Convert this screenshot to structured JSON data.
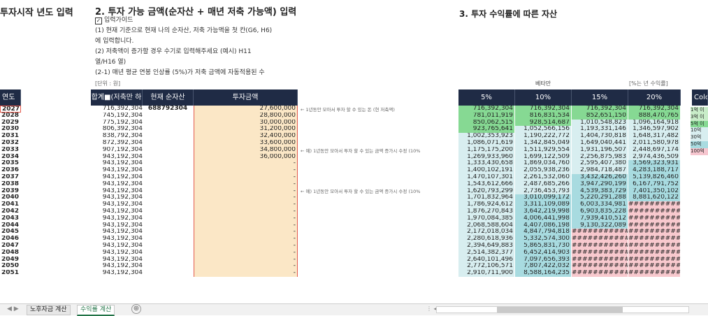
{
  "left_heading": "투자시작 년도 입력",
  "section2_title": "2. 투자 가능 금액(순자산 + 매년 저축 가능액) 입력",
  "section3_title": "3. 투자 수익률에 따른 자산",
  "guide_lines": [
    "입력가이드",
    "(1) 현재 기준으로 현재 나의 순자산, 저축 가능액을 첫 칸(G6, H6)",
    "에 입력합니다.",
    "(2) 저축액이 증가할 경우 수기로 입력해주세요 (예시) H11",
    "열/H16 열)",
    "(2-1) 매년 평균 연봉 인상률 (5%)가 저축 금액에 자동적용된 수"
  ],
  "unit_label": "[단위 : 원]",
  "vita_label": "베타만",
  "pct_label": "[%는 년 수익률]",
  "headers": {
    "year": "연도",
    "total": "합계■(저축만 하",
    "net": "현재 순자산",
    "invest": "투자금액",
    "r5": "5%",
    "r10": "10%",
    "r15": "15%",
    "r20": "20%",
    "color": "Colo"
  },
  "notes": [
    "← 1년동안 모아서 투자 할 수 있는 돈 (현 저축액)",
    "← 예) 1년동안 모아서 투자 할 수 있는 금액 증가시 수정 (10%",
    "← 예) 1년동안 모아서 투자 할 수 있는 금액 증가시 수정 (10%"
  ],
  "legend": [
    "1억 이",
    "3억 이",
    "5억 이",
    "10억",
    "30억",
    "50억",
    "100억"
  ],
  "colors": {
    "header_bg": "#1f2b45",
    "invest_bg": "#fbe7c6",
    "selection_border": "#e2584b",
    "green": "#86d993",
    "light_green": "#c8ecc8",
    "pale_teal": "#d8eef0",
    "teal": "#a8dbe0",
    "pink": "#f6c6cf",
    "overflow": "#f8c9ce"
  },
  "rows": [
    {
      "year": "2027",
      "total": "716,392,304",
      "net": "688792304",
      "invest": "27,600,000",
      "r5": "716,392,304",
      "r10": "716,392,304",
      "r15": "716,392,304",
      "r20": "716,392,304",
      "bg5": "green",
      "bg10": "green",
      "bg15": "green",
      "bg20": "green"
    },
    {
      "year": "2028",
      "total": "745,192,304",
      "net": "",
      "invest": "28,800,000",
      "r5": "781,011,919",
      "r10": "816,831,534",
      "r15": "852,651,150",
      "r20": "888,470,765",
      "bg5": "green",
      "bg10": "green",
      "bg15": "green",
      "bg20": "green"
    },
    {
      "year": "2029",
      "total": "775,192,304",
      "net": "",
      "invest": "30,000,000",
      "r5": "850,062,515",
      "r10": "928,514,687",
      "r15": "1,010,548,823",
      "r20": "1,096,164,918",
      "bg5": "green",
      "bg10": "green",
      "bg15": "pale_teal",
      "bg20": "pale_teal"
    },
    {
      "year": "2030",
      "total": "806,392,304",
      "net": "",
      "invest": "31,200,000",
      "r5": "923,765,641",
      "r10": "1,052,566,156",
      "r15": "1,193,331,146",
      "r20": "1,346,597,902",
      "bg5": "green",
      "bg10": "pale_teal",
      "bg15": "pale_teal",
      "bg20": "pale_teal"
    },
    {
      "year": "2031",
      "total": "838,792,304",
      "net": "",
      "invest": "32,400,000",
      "r5": "1,002,353,923",
      "r10": "1,190,222,772",
      "r15": "1,404,730,818",
      "r20": "1,648,317,482",
      "bg5": "pale_teal",
      "bg10": "pale_teal",
      "bg15": "pale_teal",
      "bg20": "pale_teal"
    },
    {
      "year": "2032",
      "total": "872,392,304",
      "net": "",
      "invest": "33,600,000",
      "r5": "1,086,071,619",
      "r10": "1,342,845,049",
      "r15": "1,649,040,441",
      "r20": "2,011,580,978",
      "bg5": "pale_teal",
      "bg10": "pale_teal",
      "bg15": "pale_teal",
      "bg20": "pale_teal"
    },
    {
      "year": "2033",
      "total": "907,192,304",
      "net": "",
      "invest": "34,800,000",
      "r5": "1,175,175,200",
      "r10": "1,511,929,554",
      "r15": "1,931,196,507",
      "r20": "2,448,697,174",
      "bg5": "pale_teal",
      "bg10": "pale_teal",
      "bg15": "pale_teal",
      "bg20": "pale_teal"
    },
    {
      "year": "2034",
      "total": "943,192,304",
      "net": "",
      "invest": "36,000,000",
      "r5": "1,269,933,960",
      "r10": "1,699,122,509",
      "r15": "2,256,875,983",
      "r20": "2,974,436,509",
      "bg5": "pale_teal",
      "bg10": "pale_teal",
      "bg15": "pale_teal",
      "bg20": "pale_teal"
    },
    {
      "year": "2035",
      "total": "943,192,304",
      "net": "",
      "invest": "-",
      "r5": "1,333,430,658",
      "r10": "1,869,034,760",
      "r15": "2,595,407,380",
      "r20": "3,569,323,931",
      "bg5": "pale_teal",
      "bg10": "pale_teal",
      "bg15": "pale_teal",
      "bg20": "teal"
    },
    {
      "year": "2036",
      "total": "943,192,304",
      "net": "",
      "invest": "-",
      "r5": "1,400,102,191",
      "r10": "2,055,938,236",
      "r15": "2,984,718,487",
      "r20": "4,283,188,717",
      "bg5": "pale_teal",
      "bg10": "pale_teal",
      "bg15": "pale_teal",
      "bg20": "teal"
    },
    {
      "year": "2037",
      "total": "943,192,304",
      "net": "",
      "invest": "-",
      "r5": "1,470,107,301",
      "r10": "2,261,532,060",
      "r15": "3,432,426,260",
      "r20": "5,139,826,460",
      "bg5": "pale_teal",
      "bg10": "pale_teal",
      "bg15": "teal",
      "bg20": "teal"
    },
    {
      "year": "2038",
      "total": "943,192,304",
      "net": "",
      "invest": "-",
      "r5": "1,543,612,666",
      "r10": "2,487,685,266",
      "r15": "3,947,290,199",
      "r20": "6,167,791,752",
      "bg5": "pale_teal",
      "bg10": "pale_teal",
      "bg15": "teal",
      "bg20": "teal"
    },
    {
      "year": "2039",
      "total": "943,192,304",
      "net": "",
      "invest": "-",
      "r5": "1,620,793,299",
      "r10": "2,736,453,793",
      "r15": "4,539,383,729",
      "r20": "7,401,350,102",
      "bg5": "pale_teal",
      "bg10": "pale_teal",
      "bg15": "teal",
      "bg20": "teal"
    },
    {
      "year": "2040",
      "total": "943,192,304",
      "net": "",
      "invest": "-",
      "r5": "1,701,832,964",
      "r10": "3,010,099,172",
      "r15": "5,220,291,288",
      "r20": "8,881,620,122",
      "bg5": "pale_teal",
      "bg10": "teal",
      "bg15": "teal",
      "bg20": "teal"
    },
    {
      "year": "2041",
      "total": "943,192,304",
      "net": "",
      "invest": "-",
      "r5": "1,786,924,612",
      "r10": "3,311,109,089",
      "r15": "6,003,334,981",
      "r20": "############",
      "bg5": "pale_teal",
      "bg10": "teal",
      "bg15": "teal",
      "bg20": "overflow"
    },
    {
      "year": "2042",
      "total": "943,192,304",
      "net": "",
      "invest": "-",
      "r5": "1,876,270,843",
      "r10": "3,642,219,998",
      "r15": "6,903,835,228",
      "r20": "############",
      "bg5": "pale_teal",
      "bg10": "teal",
      "bg15": "teal",
      "bg20": "overflow"
    },
    {
      "year": "2043",
      "total": "943,192,304",
      "net": "",
      "invest": "-",
      "r5": "1,970,084,385",
      "r10": "4,006,441,998",
      "r15": "7,939,410,512",
      "r20": "############",
      "bg5": "pale_teal",
      "bg10": "teal",
      "bg15": "teal",
      "bg20": "overflow"
    },
    {
      "year": "2044",
      "total": "943,192,304",
      "net": "",
      "invest": "-",
      "r5": "2,068,588,604",
      "r10": "4,407,086,198",
      "r15": "9,130,322,089",
      "r20": "############",
      "bg5": "pale_teal",
      "bg10": "teal",
      "bg15": "teal",
      "bg20": "overflow"
    },
    {
      "year": "2045",
      "total": "943,192,304",
      "net": "",
      "invest": "-",
      "r5": "2,172,018,034",
      "r10": "4,847,794,818",
      "r15": "############",
      "r20": "############",
      "bg5": "pale_teal",
      "bg10": "teal",
      "bg15": "overflow",
      "bg20": "overflow"
    },
    {
      "year": "2046",
      "total": "943,192,304",
      "net": "",
      "invest": "-",
      "r5": "2,280,618,936",
      "r10": "5,332,574,300",
      "r15": "############",
      "r20": "############",
      "bg5": "pale_teal",
      "bg10": "teal",
      "bg15": "overflow",
      "bg20": "overflow"
    },
    {
      "year": "2047",
      "total": "943,192,304",
      "net": "",
      "invest": "-",
      "r5": "2,394,649,883",
      "r10": "5,865,831,730",
      "r15": "############",
      "r20": "############",
      "bg5": "pale_teal",
      "bg10": "teal",
      "bg15": "overflow",
      "bg20": "overflow"
    },
    {
      "year": "2048",
      "total": "943,192,304",
      "net": "",
      "invest": "-",
      "r5": "2,514,382,377",
      "r10": "6,452,414,903",
      "r15": "############",
      "r20": "############",
      "bg5": "pale_teal",
      "bg10": "teal",
      "bg15": "overflow",
      "bg20": "overflow"
    },
    {
      "year": "2049",
      "total": "943,192,304",
      "net": "",
      "invest": "-",
      "r5": "2,640,101,496",
      "r10": "7,097,656,393",
      "r15": "############",
      "r20": "############",
      "bg5": "pale_teal",
      "bg10": "teal",
      "bg15": "overflow",
      "bg20": "overflow"
    },
    {
      "year": "2050",
      "total": "943,192,304",
      "net": "",
      "invest": "-",
      "r5": "2,772,106,571",
      "r10": "7,807,422,032",
      "r15": "############",
      "r20": "############",
      "bg5": "pale_teal",
      "bg10": "teal",
      "bg15": "overflow",
      "bg20": "overflow"
    },
    {
      "year": "2051",
      "total": "943,192,304",
      "net": "",
      "invest": "-",
      "r5": "2,910,711,900",
      "r10": "8,588,164,235",
      "r15": "############",
      "r20": "############",
      "bg5": "pale_teal",
      "bg10": "teal",
      "bg15": "overflow",
      "bg20": "overflow"
    }
  ],
  "tabs": [
    "노후자금 계산",
    "수익률 계산"
  ],
  "tab_add_symbol": "⊕",
  "nav_symbols": "◀ ▶"
}
